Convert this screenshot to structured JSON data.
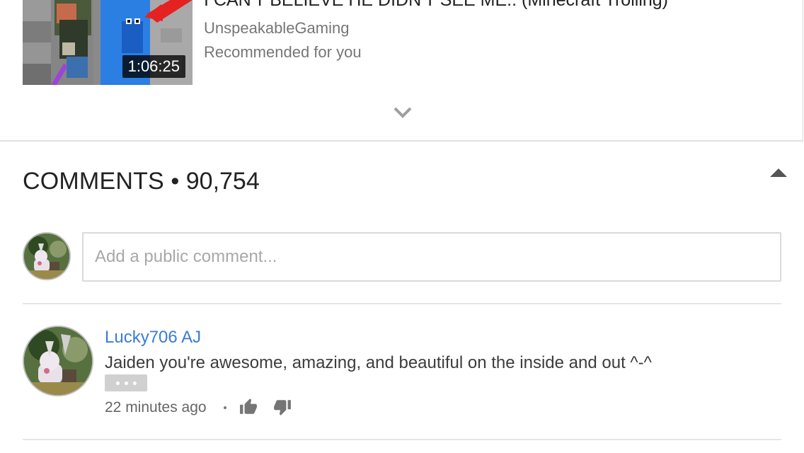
{
  "recommended": {
    "title": "I CAN'T BELIEVE HE DIDN'T SEE ME.. (Minecraft Trolling)",
    "channel": "UnspeakableGaming",
    "label": "Recommended for you",
    "duration": "1:06:25"
  },
  "comments": {
    "heading": "COMMENTS",
    "separator": "•",
    "count": "90,754",
    "input_placeholder": "Add a public comment...",
    "items": [
      {
        "author": "Lucky706 AJ",
        "text": "Jaiden you're awesome, amazing, and beautiful on the inside and out ^-^",
        "time": "22 minutes ago"
      }
    ]
  },
  "colors": {
    "author_link": "#3a7bd5",
    "secondary_text": "#767676",
    "icon_gray": "#757575"
  },
  "icons": {
    "expand": "chevron-down-icon",
    "collapse": "caret-up-icon",
    "more": "more-horiz-icon",
    "like": "thumbs-up-icon",
    "dislike": "thumbs-down-icon"
  }
}
